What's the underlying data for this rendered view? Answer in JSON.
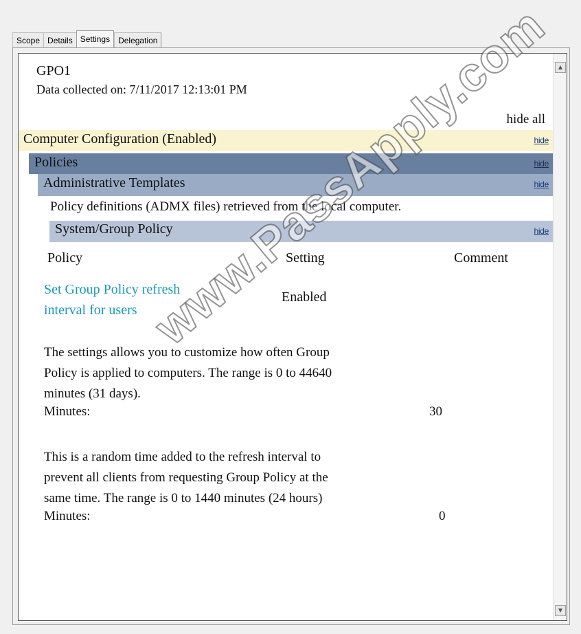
{
  "tabs": [
    {
      "label": "Scope",
      "active": false
    },
    {
      "label": "Details",
      "active": false
    },
    {
      "label": "Settings",
      "active": true
    },
    {
      "label": "Delegation",
      "active": false
    }
  ],
  "report": {
    "gpo_name": "GPO1",
    "data_collected": "Data collected on: 7/11/2017 12:13:01 PM",
    "hide_all": "hide all",
    "computer_configuration": {
      "title": "Computer Configuration (Enabled)",
      "hide": "hide"
    },
    "policies": {
      "title": "Policies",
      "hide": "hide"
    },
    "administrative_templates": {
      "title": "Administrative Templates",
      "hide": "hide"
    },
    "definitions_note": "Policy definitions (ADMX files) retrieved from the local computer.",
    "system_group_policy": {
      "title": "System/Group Policy",
      "hide": "hide"
    },
    "table_headers": {
      "policy": "Policy",
      "setting": "Setting",
      "comment": "Comment"
    },
    "policy_row": {
      "name_line1": "Set Group Policy refresh",
      "name_line2": "interval for users",
      "setting": "Enabled"
    },
    "description1": {
      "line1": "The settings allows you to customize how often Group",
      "line2": "Policy is applied to computers. The range is 0 to 44640",
      "line3": "minutes (31 days).",
      "minutes_label": "Minutes:",
      "minutes_value": "30"
    },
    "description2": {
      "line1": "This is a random time added to the refresh interval to",
      "line2": "prevent all clients from requesting Group Policy at the",
      "line3": "same time. The range is 0 to 1440 minutes (24 hours)",
      "minutes_label": "Minutes:",
      "minutes_value": "0"
    }
  },
  "watermark": "www.PassApply.com"
}
